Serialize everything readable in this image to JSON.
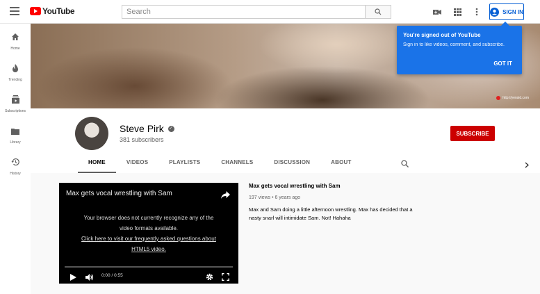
{
  "header": {
    "logo_text": "YouTube",
    "search_placeholder": "Search",
    "signin_label": "SIGN IN"
  },
  "sidebar": {
    "items": [
      {
        "label": "Home",
        "icon": "home-icon"
      },
      {
        "label": "Trending",
        "icon": "flame-icon"
      },
      {
        "label": "Subscriptions",
        "icon": "subscriptions-icon"
      },
      {
        "label": "Library",
        "icon": "folder-icon"
      },
      {
        "label": "History",
        "icon": "history-icon"
      }
    ]
  },
  "banner": {
    "url_text": "http://yensid.com"
  },
  "popup": {
    "title": "You're signed out of YouTube",
    "text": "Sign in to like videos, comment, and subscribe.",
    "button": "GOT IT"
  },
  "channel": {
    "name": "Steve Pirk",
    "subscribers": "381 subscribers",
    "subscribe_label": "SUBSCRIBE",
    "tabs": [
      "HOME",
      "VIDEOS",
      "PLAYLISTS",
      "CHANNELS",
      "DISCUSSION",
      "ABOUT"
    ],
    "active_tab": "HOME"
  },
  "player": {
    "title": "Max gets vocal wrestling with Sam",
    "message_line1": "Your browser does not currently recognize any of the",
    "message_line2": "video formats available.",
    "link_line1": "Click here to visit our frequently asked questions about",
    "link_line2": "HTML5 video.",
    "time": "0:00 / 0:55",
    "progress": 0
  },
  "video": {
    "title": "Max gets vocal wrestling with Sam",
    "meta": "197 views • 6 years ago",
    "description": "Max and Sam doing a little afternoon wrestling. Max has decided that a nasty snarl will intimidate Sam. Not! Hahaha"
  },
  "colors": {
    "brand_red": "#ff0000",
    "subscribe_red": "#cc0000",
    "signin_blue": "#065fd4",
    "popup_blue": "#1a73e8"
  }
}
